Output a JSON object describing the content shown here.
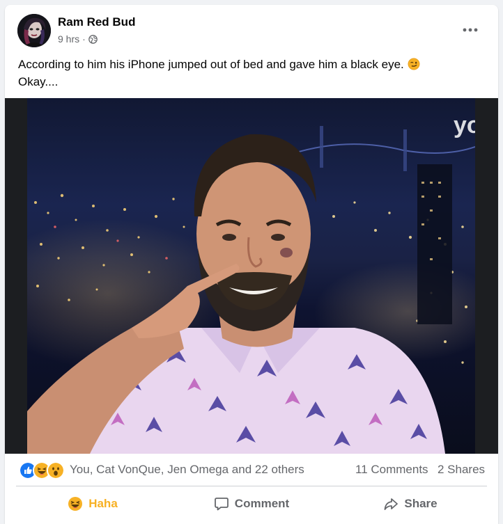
{
  "post": {
    "author": "Ram Red Bud",
    "time": "9 hrs",
    "separator": "·",
    "privacy_icon": "globe-icon",
    "more_icon": "more-options-icon",
    "text_line1": "According to him his iPhone jumped out of bed and gave him a black eye.",
    "text_line2": "Okay....",
    "text_emoji": "smirk-emoji-icon"
  },
  "media": {
    "watermark": "yo"
  },
  "stats": {
    "reaction_icons": [
      "like-reaction-icon",
      "haha-reaction-icon",
      "wow-reaction-icon"
    ],
    "reaction_names": "You, Cat VonQue, Jen Omega and 22 others",
    "comments": "11 Comments",
    "shares": "2 Shares"
  },
  "actions": {
    "haha_label": "Haha",
    "comment_label": "Comment",
    "share_label": "Share"
  },
  "colors": {
    "accent_haha": "#f7b125",
    "like_blue": "#1877f2",
    "secondary_text": "#65676b"
  }
}
